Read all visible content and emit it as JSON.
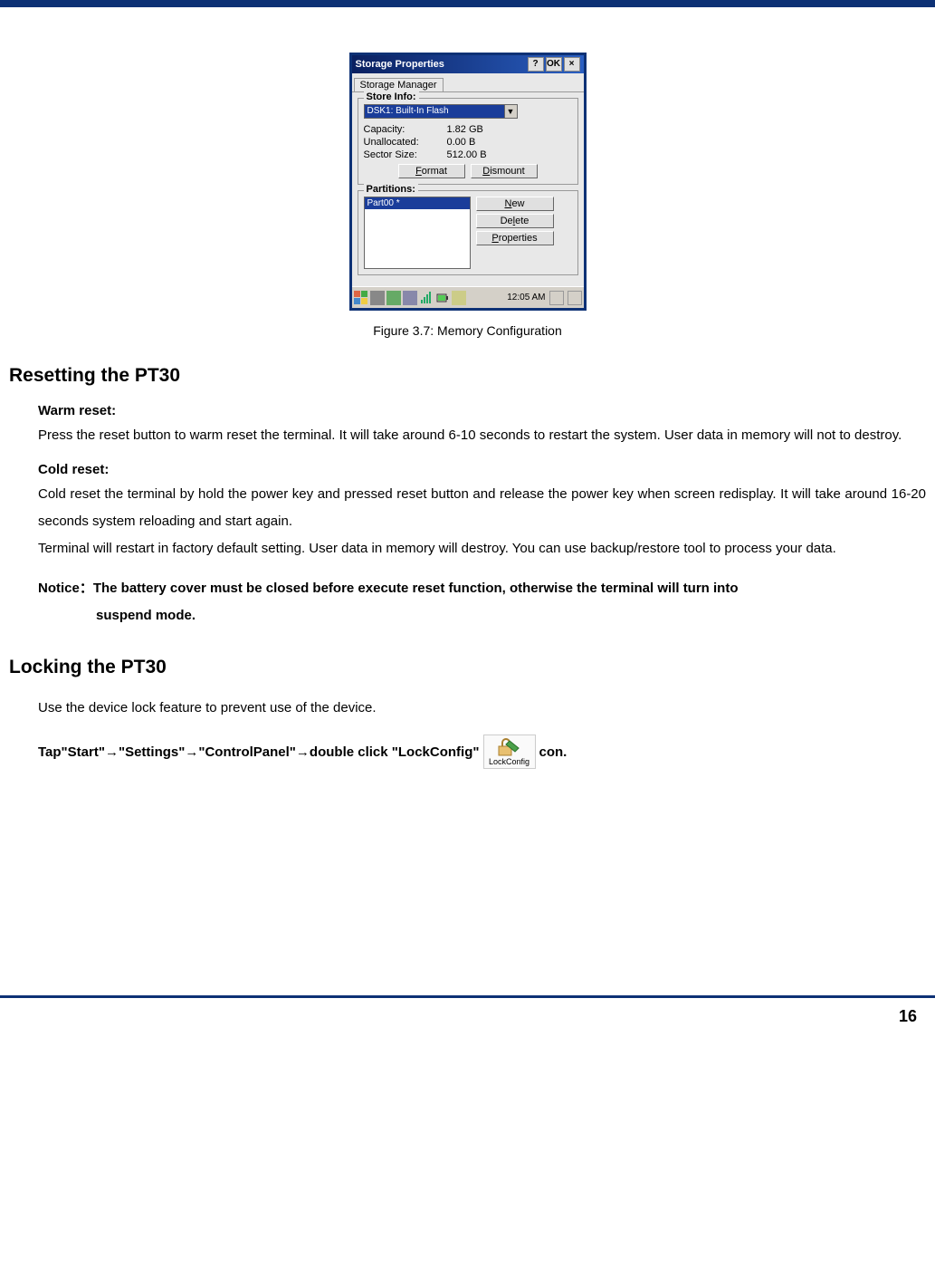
{
  "figure": {
    "window_title": "Storage Properties",
    "help_btn": "?",
    "ok_btn": "OK",
    "close_btn": "×",
    "tab": "Storage Manager",
    "store_info_legend": "Store Info:",
    "dropdown_selected": "DSK1: Built-In Flash",
    "capacity_label": "Capacity:",
    "capacity_value": "1.82 GB",
    "unallocated_label": "Unallocated:",
    "unallocated_value": "0.00 B",
    "sector_label": "Sector Size:",
    "sector_value": "512.00 B",
    "format_btn": "Format",
    "dismount_btn": "Dismount",
    "partitions_legend": "Partitions:",
    "partition_item": "Part00 *",
    "new_btn": "New",
    "delete_btn": "Delete",
    "properties_btn": "Properties",
    "taskbar_time": "12:05 AM",
    "caption": "Figure 3.7: Memory Configuration"
  },
  "sections": {
    "h1": "Resetting the PT30",
    "warm_head": "Warm reset:",
    "warm_body": "Press the reset button to warm reset the terminal. It will take around 6-10 seconds to restart the system. User data in memory will not to destroy.",
    "cold_head": "Cold reset:",
    "cold_body1": "Cold reset the terminal by hold the power key and pressed reset button and release the power key when screen redisplay. It will take around 16-20 seconds system reloading and start again.",
    "cold_body2": "Terminal will restart in factory default setting. User data in memory will destroy. You can use backup/restore tool to process your data.",
    "notice": "Notice：The battery cover must be closed before execute reset function, otherwise the terminal will turn into",
    "notice_cont": "suspend mode.",
    "h2": "Locking the PT30",
    "lock_body": "Use the device lock feature to prevent use of the device.",
    "lock_steps_pre": "Tap\"Start\"→\"Settings\"→\"ControlPanel\"→double click \"LockConfig\"",
    "lock_steps_post": "con.",
    "lockconfig_label": "LockConfig"
  },
  "page_number": "16"
}
